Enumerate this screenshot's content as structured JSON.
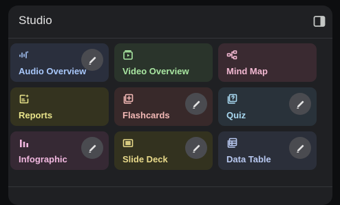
{
  "panel": {
    "title": "Studio",
    "toggle_icon": "side-panel-icon"
  },
  "cards": [
    {
      "label": "Audio Overview",
      "icon": "audio-waveform-icon",
      "color": "#a8c7fa",
      "bg": "#2a2f3d",
      "edit": true
    },
    {
      "label": "Video Overview",
      "icon": "video-play-icon",
      "color": "#a8e6a1",
      "bg": "#2a342b",
      "edit": false
    },
    {
      "label": "Mind Map",
      "icon": "mind-map-icon",
      "color": "#f2b8d2",
      "bg": "#3a2a31",
      "edit": false
    },
    {
      "label": "Reports",
      "icon": "reports-sparkle-icon",
      "color": "#e8e38a",
      "bg": "#34331f",
      "edit": false
    },
    {
      "label": "Flashcards",
      "icon": "flashcards-icon",
      "color": "#f2b8b5",
      "bg": "#38292a",
      "edit": true
    },
    {
      "label": "Quiz",
      "icon": "quiz-icon",
      "color": "#a8d8f0",
      "bg": "#29323a",
      "edit": true
    },
    {
      "label": "Infographic",
      "icon": "bar-chart-icon",
      "color": "#f2b8e0",
      "bg": "#362934",
      "edit": true
    },
    {
      "label": "Slide Deck",
      "icon": "slide-deck-icon",
      "color": "#e8d98a",
      "bg": "#33321f",
      "edit": true
    },
    {
      "label": "Data Table",
      "icon": "table-icon",
      "color": "#b8c8f0",
      "bg": "#2b2f3a",
      "edit": true
    }
  ]
}
